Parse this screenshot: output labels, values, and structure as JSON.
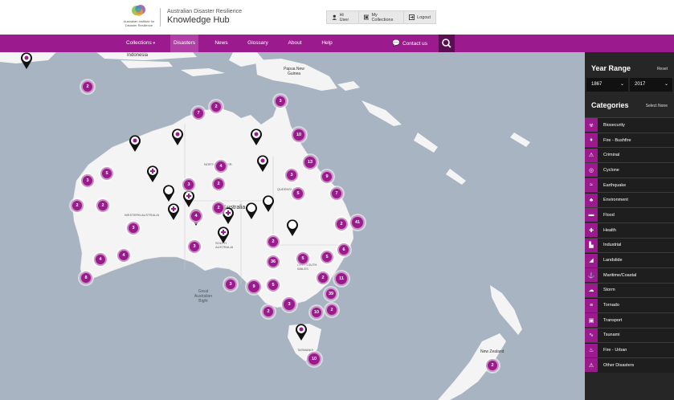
{
  "header": {
    "logo_text": "Australian Institute for Disaster Resilience",
    "site_subtitle": "Australian Disaster Resilience",
    "site_title": "Knowledge Hub",
    "user_buttons": [
      {
        "label": "Hi User",
        "icon": "user-icon"
      },
      {
        "label": "My Collections",
        "icon": "collections-icon"
      },
      {
        "label": "Logout",
        "icon": "logout-icon"
      }
    ]
  },
  "nav": {
    "items": [
      "Collections",
      "Disasters",
      "News",
      "Glossary",
      "About",
      "Help"
    ],
    "active": "Disasters",
    "contact_label": "Contact us"
  },
  "sidebar": {
    "year_range_title": "Year Range",
    "reset_label": "Reset",
    "year_from": "1867",
    "year_to": "2017",
    "categories_title": "Categories",
    "select_none_label": "Select None",
    "categories": [
      {
        "label": "Biosecurity",
        "icon": "biohazard-icon",
        "glyph": "☣"
      },
      {
        "label": "Fire - Bushfire",
        "icon": "flame-icon",
        "glyph": "♦"
      },
      {
        "label": "Criminal",
        "icon": "criminal-icon",
        "glyph": "⚠"
      },
      {
        "label": "Cyclone",
        "icon": "cyclone-icon",
        "glyph": "◎"
      },
      {
        "label": "Earthquake",
        "icon": "earthquake-icon",
        "glyph": "≈"
      },
      {
        "label": "Environment",
        "icon": "environment-icon",
        "glyph": "♣"
      },
      {
        "label": "Flood",
        "icon": "flood-icon",
        "glyph": "▬"
      },
      {
        "label": "Health",
        "icon": "health-cross-icon",
        "glyph": "✚"
      },
      {
        "label": "Industrial",
        "icon": "factory-icon",
        "glyph": "▙"
      },
      {
        "label": "Landslide",
        "icon": "landslide-icon",
        "glyph": "◢"
      },
      {
        "label": "Maritime/Coastal",
        "icon": "maritime-icon",
        "glyph": "⚓"
      },
      {
        "label": "Storm",
        "icon": "storm-icon",
        "glyph": "☁"
      },
      {
        "label": "Tornado",
        "icon": "tornado-icon",
        "glyph": "≡"
      },
      {
        "label": "Transport",
        "icon": "transport-icon",
        "glyph": "▣"
      },
      {
        "label": "Tsunami",
        "icon": "tsunami-icon",
        "glyph": "∿"
      },
      {
        "label": "Fire - Urban",
        "icon": "urban-fire-icon",
        "glyph": "♨"
      },
      {
        "label": "Other Disasters",
        "icon": "warning-icon",
        "glyph": "⚠"
      }
    ]
  },
  "map": {
    "labels": {
      "indonesia": "Indonesia",
      "png": "Papua New Guinea",
      "northern_territory": "NORTHERN TERR.",
      "queensland": "QUEENSLAND",
      "western_australia": "WESTERN AUSTRALIA",
      "south_australia": "SOUTH AUSTRALIA",
      "nsw": "NEW SOUTH WALES",
      "tasmania": "TASMANIA",
      "new_zealand": "New Zealand",
      "great_australian_bight": "Great Australian Bight",
      "australia": "Australia"
    },
    "clusters": [
      "2",
      "2",
      "7",
      "3",
      "10",
      "3",
      "5",
      "4",
      "13",
      "9",
      "3",
      "2",
      "3",
      "5",
      "7",
      "2",
      "2",
      "2",
      "4",
      "41",
      "3",
      "2",
      "3",
      "2",
      "4",
      "6",
      "4",
      "5",
      "5",
      "8",
      "36",
      "2",
      "11",
      "3",
      "39",
      "9",
      "5",
      "3",
      "10",
      "2",
      "2"
    ]
  },
  "colors": {
    "brand": "#9b1a8e",
    "nav_dark": "#5a0f52",
    "sidebar_bg": "#262626",
    "ocean": "#a8b4c2",
    "land": "#f4f4f4"
  }
}
